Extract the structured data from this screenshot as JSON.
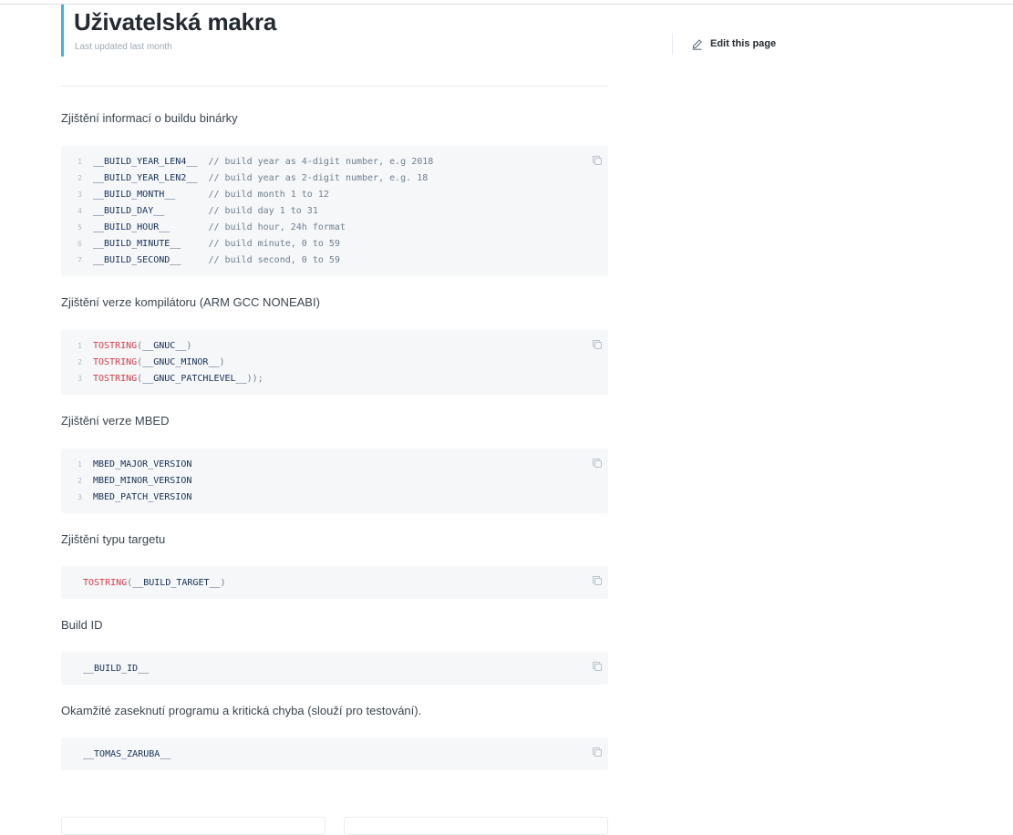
{
  "page": {
    "title": "Uživatelská makra",
    "updated": "Last updated last month",
    "edit_label": "Edit this page"
  },
  "sections": {
    "binary_info": {
      "heading": "Zjištění informací o buildu binárky",
      "lines": [
        {
          "num": "1",
          "code": "__BUILD_YEAR_LEN4__  ",
          "comment": "// build year as 4-digit number, e.g 2018"
        },
        {
          "num": "2",
          "code": "__BUILD_YEAR_LEN2__  ",
          "comment": "// build year as 2-digit number, e.g. 18"
        },
        {
          "num": "3",
          "code": "__BUILD_MONTH__      ",
          "comment": "// build month 1 to 12"
        },
        {
          "num": "4",
          "code": "__BUILD_DAY__        ",
          "comment": "// build day 1 to 31"
        },
        {
          "num": "5",
          "code": "__BUILD_HOUR__       ",
          "comment": "// build hour, 24h format"
        },
        {
          "num": "6",
          "code": "__BUILD_MINUTE__     ",
          "comment": "// build minute, 0 to 59"
        },
        {
          "num": "7",
          "code": "__BUILD_SECOND__     ",
          "comment": "// build second, 0 to 59"
        }
      ]
    },
    "compiler": {
      "heading": "Zjištění verze kompilátoru (ARM GCC NONEABI)",
      "lines": [
        {
          "num": "1",
          "fn": "TOSTRING",
          "open": "(",
          "arg": "__GNUC__",
          "close": ")"
        },
        {
          "num": "2",
          "fn": "TOSTRING",
          "open": "(",
          "arg": "__GNUC_MINOR__",
          "close": ")"
        },
        {
          "num": "3",
          "fn": "TOSTRING",
          "open": "(",
          "arg": "__GNUC_PATCHLEVEL__",
          "close": "));"
        }
      ]
    },
    "mbed": {
      "heading": "Zjištění verze MBED",
      "lines": [
        {
          "num": "1",
          "code": "MBED_MAJOR_VERSION"
        },
        {
          "num": "2",
          "code": "MBED_MINOR_VERSION"
        },
        {
          "num": "3",
          "code": "MBED_PATCH_VERSION"
        }
      ]
    },
    "target": {
      "heading": "Zjištění typu targetu",
      "fn": "TOSTRING",
      "open": "(",
      "arg": "__BUILD_TARGET__",
      "close": ")"
    },
    "build_id": {
      "heading": "Build ID",
      "code": "__BUILD_ID__"
    },
    "crash": {
      "heading": "Okamžité zaseknutí programu a kritická chyba (slouží pro testování).",
      "code": "__TOMAS_ZARUBA__"
    }
  },
  "icons": {
    "edit": "pencil-icon",
    "copy": "copy-icon"
  },
  "colors": {
    "accent": "#3eb4d4",
    "code_bg": "#f5f7f9",
    "keyword": "#d73a49",
    "comment": "#707f8f"
  }
}
